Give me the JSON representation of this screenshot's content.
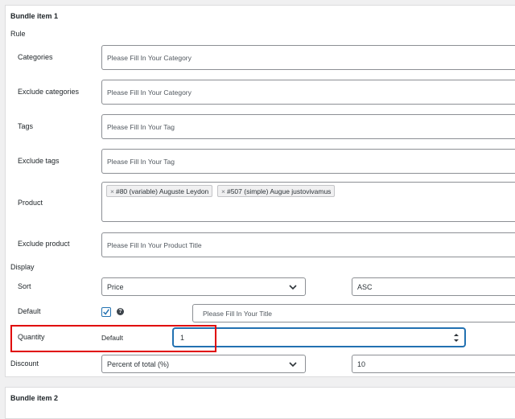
{
  "bundle1": {
    "title": "Bundle item 1",
    "rule_heading": "Rule",
    "categories": {
      "label": "Categories",
      "placeholder": "Please Fill In Your Category"
    },
    "exclude_categories": {
      "label": "Exclude categories",
      "placeholder": "Please Fill In Your Category"
    },
    "tags": {
      "label": "Tags",
      "placeholder": "Please Fill In Your Tag"
    },
    "exclude_tags": {
      "label": "Exclude tags",
      "placeholder": "Please Fill In Your Tag"
    },
    "product": {
      "label": "Product",
      "tags": [
        "#80 (variable) Auguste Leydon",
        "#507 (simple) Augue justovivamus"
      ]
    },
    "exclude_product": {
      "label": "Exclude product",
      "placeholder": "Please Fill In Your Product Title"
    },
    "display_heading": "Display",
    "sort": {
      "label": "Sort",
      "value": "Price",
      "order": "ASC"
    },
    "default": {
      "label": "Default",
      "title_placeholder": "Please Fill In Your Title",
      "checked": true
    },
    "quantity": {
      "label": "Quantity",
      "mode": "Default",
      "value": "1"
    },
    "discount": {
      "label": "Discount",
      "value": "Percent of total (%)",
      "amount": "10"
    }
  },
  "bundle2": {
    "title": "Bundle item 2"
  },
  "colors": {
    "accent": "#2271b1",
    "highlight": "#e00000"
  },
  "icons": {
    "dropdown": "chevron-down-icon",
    "remove": "close-icon",
    "help": "help-icon",
    "checkbox": "checkmark-icon",
    "spinner": "spinner-arrows-icon"
  }
}
